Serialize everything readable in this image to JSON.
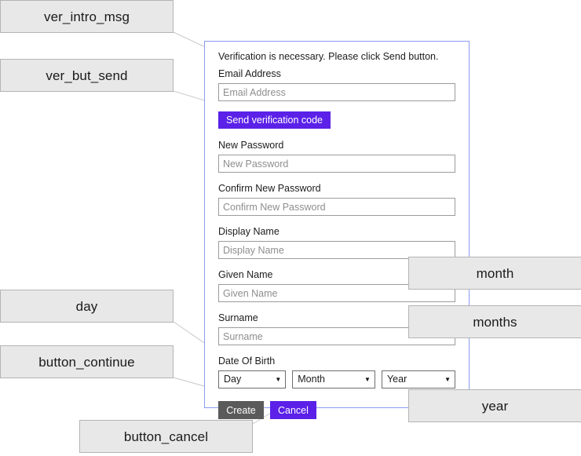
{
  "panel": {
    "intro_message": "Verification is necessary. Please click Send button.",
    "fields": [
      {
        "label": "Email Address",
        "placeholder": "Email Address",
        "value": ""
      },
      {
        "label": "New Password",
        "placeholder": "New Password",
        "value": ""
      },
      {
        "label": "Confirm New Password",
        "placeholder": "Confirm New Password",
        "value": ""
      },
      {
        "label": "Display Name",
        "placeholder": "Display Name",
        "value": ""
      },
      {
        "label": "Given Name",
        "placeholder": "Given Name",
        "value": ""
      },
      {
        "label": "Surname",
        "placeholder": "Surname",
        "value": ""
      }
    ],
    "send_button_label": "Send verification code",
    "dob": {
      "label": "Date Of Birth",
      "day_selected": "Day",
      "month_selected": "Month",
      "year_selected": "Year",
      "caret_icon": "chevron-down-icon"
    },
    "create_button_label": "Create",
    "cancel_button_label": "Cancel",
    "border_color": "#8a9cf0"
  },
  "annotations": [
    {
      "id": "ver_intro_msg",
      "label": "ver_intro_msg"
    },
    {
      "id": "ver_but_send",
      "label": "ver_but_send"
    },
    {
      "id": "day",
      "label": "day"
    },
    {
      "id": "button_continue",
      "label": "button_continue"
    },
    {
      "id": "button_cancel",
      "label": "button_cancel"
    },
    {
      "id": "month",
      "label": "month"
    },
    {
      "id": "months",
      "label": "months"
    },
    {
      "id": "year",
      "label": "year"
    }
  ],
  "colors": {
    "accent_purple": "#5b21e8",
    "create_gray": "#5a5a5a",
    "callout_fill": "#e8e8e8",
    "callout_border": "#b4b4b4",
    "connector_line": "#c9c9c9"
  }
}
